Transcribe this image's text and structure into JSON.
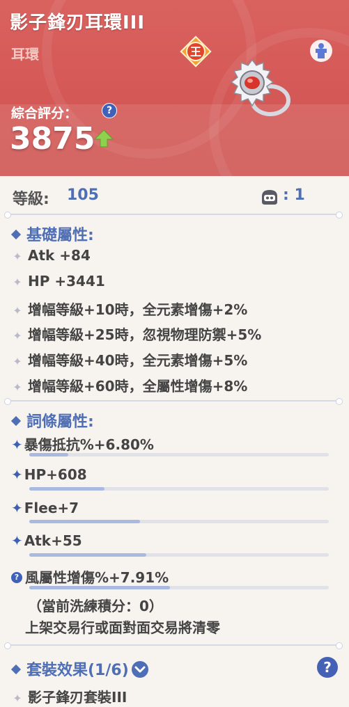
{
  "header": {
    "title": "影子鋒刃耳環III",
    "subtitle": "耳環",
    "badge_char": "王",
    "score_label": "綜合評分：",
    "score_value": "3875",
    "help": "?"
  },
  "level": {
    "label": "等級:",
    "value": "105",
    "refine_value": ": 1"
  },
  "base_section": {
    "title": "基礎屬性:",
    "lines": [
      "Atk +84",
      "HP +3441",
      "增幅等級+10時，全元素增傷+2%",
      "增幅等級+25時，忽視物理防禦+5%",
      "增幅等級+40時，全元素增傷+5%",
      "增幅等級+60時，全屬性增傷+8%"
    ]
  },
  "random_section": {
    "title": "詞條屬性:",
    "lines": [
      {
        "text": "暴傷抵抗%+6.80%",
        "level": 0.13
      },
      {
        "text": "HP+608",
        "level": 0.25
      },
      {
        "text": "Flee+7",
        "level": 0.37
      },
      {
        "text": "Atk+55",
        "level": 0.39
      },
      {
        "text": "風屬性增傷%+7.91%",
        "level": 0.47
      }
    ],
    "note_1": "（當前洗練積分：0）",
    "note_2": "上架交易行或面對面交易將清零"
  },
  "set_section": {
    "title": "套裝效果(1/6)",
    "item": "影子鋒刃套裝III",
    "help": "?"
  },
  "colors": {
    "accent": "#4e6fb6",
    "header": "#d45856",
    "up_arrow": "#8fd14f"
  }
}
